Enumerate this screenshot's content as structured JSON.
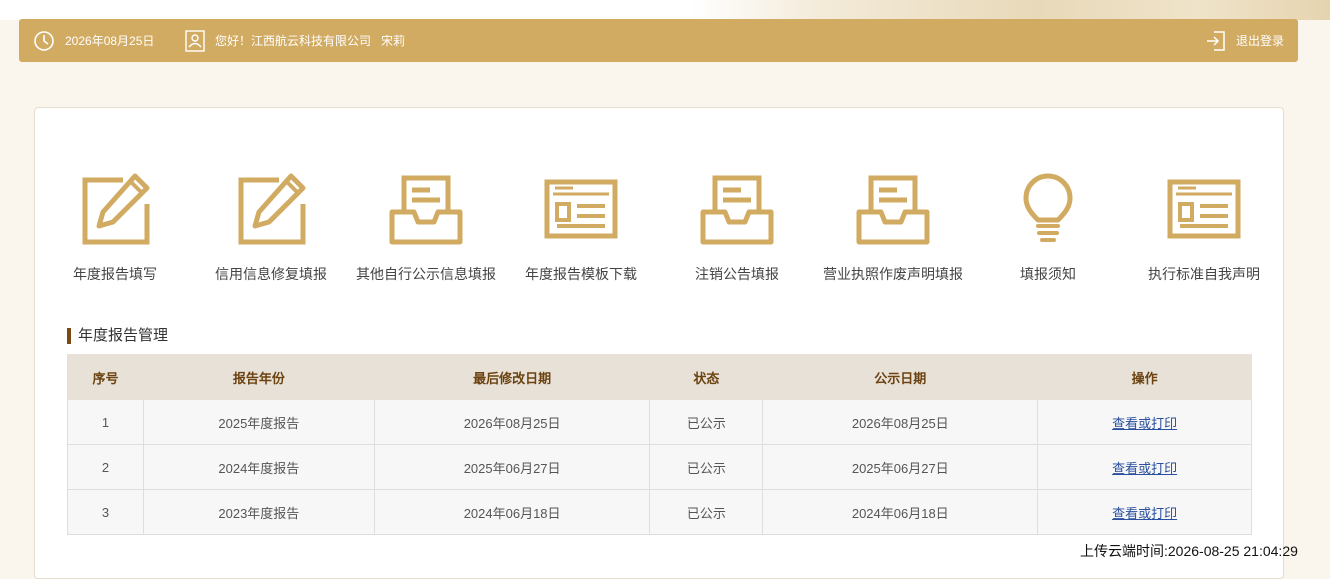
{
  "header": {
    "date": "2026年08月25日",
    "greeting": "您好！",
    "company": "江西航云科技有限公司",
    "user": "宋莉",
    "logout_label": "退出登录"
  },
  "tiles": [
    {
      "label": "年度报告填写",
      "icon": "edit-icon"
    },
    {
      "label": "信用信息修复填报",
      "icon": "edit-icon"
    },
    {
      "label": "其他自行公示信息填报",
      "icon": "inbox-document-icon"
    },
    {
      "label": "年度报告模板下载",
      "icon": "template-form-icon"
    },
    {
      "label": "注销公告填报",
      "icon": "inbox-document-icon"
    },
    {
      "label": "营业执照作废声明填报",
      "icon": "inbox-document-icon"
    },
    {
      "label": "填报须知",
      "icon": "lightbulb-icon"
    },
    {
      "label": "执行标准自我声明",
      "icon": "template-form-icon"
    }
  ],
  "section": {
    "title": "年度报告管理"
  },
  "table": {
    "columns": [
      "序号",
      "报告年份",
      "最后修改日期",
      "状态",
      "公示日期",
      "操作"
    ],
    "rows": [
      [
        "1",
        "2025年度报告",
        "2026年08月25日",
        "已公示",
        "2026年08月25日",
        "查看或打印"
      ],
      [
        "2",
        "2024年度报告",
        "2025年06月27日",
        "已公示",
        "2025年06月27日",
        "查看或打印"
      ],
      [
        "3",
        "2023年度报告",
        "2024年06月18日",
        "已公示",
        "2024年06月18日",
        "查看或打印"
      ]
    ]
  },
  "footer": {
    "upload_time": "上传云端时间:2026-08-25 21:04:29"
  },
  "colors": {
    "accent": "#d2ab62",
    "title_bar": "#7b4a14",
    "link": "#2a4f9e"
  }
}
